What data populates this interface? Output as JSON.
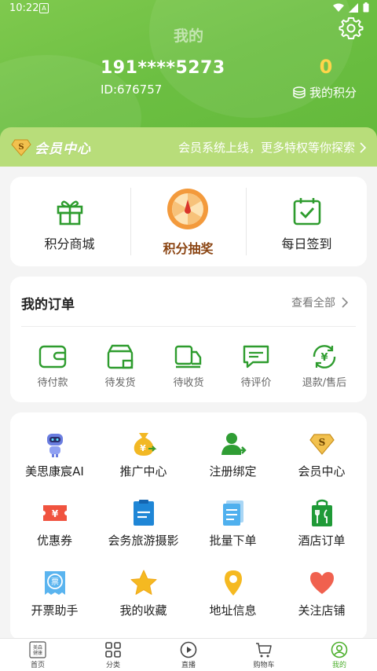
{
  "status_bar": {
    "time": "10:22",
    "app_icon_letter": "A"
  },
  "header": {
    "title": "我的",
    "phone": "191****5273",
    "user_id": "ID:676757",
    "points_value": "0",
    "points_label": "我的积分"
  },
  "member_bar": {
    "badge_letter": "S",
    "badge_text": "会员中心",
    "promo_text": "会员系统上线，更多特权等你探索"
  },
  "quick_actions": [
    {
      "label": "积分商城"
    },
    {
      "label": "积分抽奖"
    },
    {
      "label": "每日签到"
    }
  ],
  "orders": {
    "title": "我的订单",
    "view_all": "查看全部",
    "items": [
      {
        "label": "待付款"
      },
      {
        "label": "待发货"
      },
      {
        "label": "待收货"
      },
      {
        "label": "待评价"
      },
      {
        "label": "退款/售后"
      }
    ]
  },
  "services": [
    {
      "label": "美思康宸AI"
    },
    {
      "label": "推广中心"
    },
    {
      "label": "注册绑定"
    },
    {
      "label": "会员中心"
    },
    {
      "label": "优惠券"
    },
    {
      "label": "会务旅游摄影"
    },
    {
      "label": "批量下单"
    },
    {
      "label": "酒店订单"
    },
    {
      "label": "开票助手"
    },
    {
      "label": "我的收藏"
    },
    {
      "label": "地址信息"
    },
    {
      "label": "关注店铺"
    }
  ],
  "tabbar": [
    {
      "label": "首页",
      "icon_text": "美森健康"
    },
    {
      "label": "分类"
    },
    {
      "label": "直播"
    },
    {
      "label": "购物车"
    },
    {
      "label": "我的"
    }
  ],
  "colors": {
    "brand_green": "#4caf2c",
    "header_green": "#6cbf42",
    "points_yellow": "#ffd54a",
    "lottery_brown": "#8b4513"
  }
}
